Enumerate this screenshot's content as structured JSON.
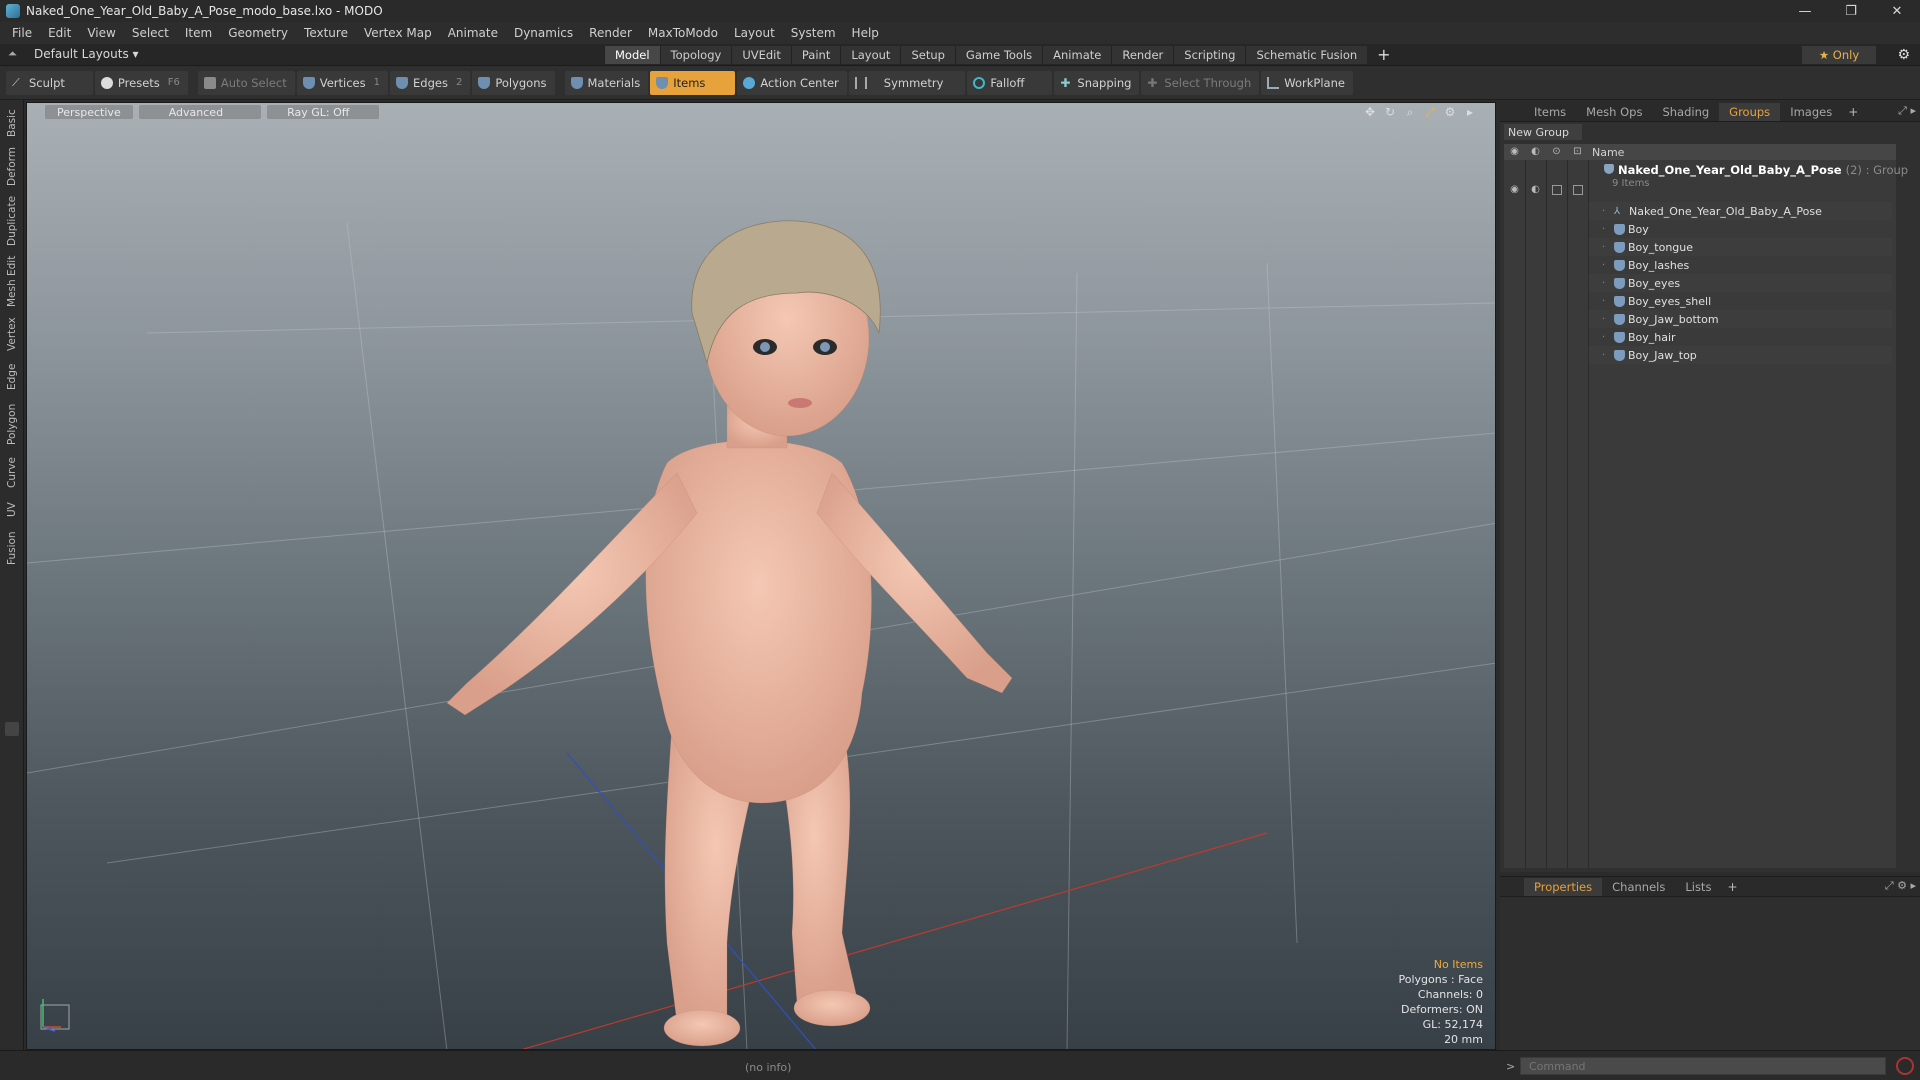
{
  "window": {
    "title": "Naked_One_Year_Old_Baby_A_Pose_modo_base.lxo - MODO"
  },
  "menu": [
    "File",
    "Edit",
    "View",
    "Select",
    "Item",
    "Geometry",
    "Texture",
    "Vertex Map",
    "Animate",
    "Dynamics",
    "Render",
    "MaxToModo",
    "Layout",
    "System",
    "Help"
  ],
  "layout": {
    "selector": "Default Layouts ▾",
    "tabs": [
      "Model",
      "Topology",
      "UVEdit",
      "Paint",
      "Layout",
      "Setup",
      "Game Tools",
      "Animate",
      "Render",
      "Scripting",
      "Schematic Fusion"
    ],
    "active_tab": "Model",
    "only": "★  Only"
  },
  "toolbar": {
    "sculpt": "Sculpt",
    "presets": "Presets",
    "presets_key": "F6",
    "auto_select": "Auto Select",
    "vertices": "Vertices",
    "vertices_key": "1",
    "edges": "Edges",
    "edges_key": "2",
    "polygons": "Polygons",
    "materials": "Materials",
    "items": "Items",
    "action_center": "Action Center",
    "symmetry": "Symmetry",
    "falloff": "Falloff",
    "snapping": "Snapping",
    "select_through": "Select Through",
    "workplane": "WorkPlane"
  },
  "left_tabs": [
    "Basic",
    "Deform",
    "Duplicate",
    "Mesh Edit",
    "Vertex",
    "Edge",
    "Polygon",
    "Curve",
    "UV",
    "Fusion"
  ],
  "viewport": {
    "view": "Perspective",
    "shading": "Advanced",
    "raygl": "Ray GL: Off",
    "info": {
      "selection": "No Items",
      "polygons": "Polygons : Face",
      "channels": "Channels: 0",
      "deformers": "Deformers: ON",
      "gl": "GL: 52,174",
      "scale": "20 mm"
    }
  },
  "panel": {
    "tabs": [
      "Items",
      "Mesh Ops",
      "Shading",
      "Groups",
      "Images"
    ],
    "active_tab": "Groups",
    "new_group": "New Group",
    "column_name": "Name",
    "group": {
      "name": "Naked_One_Year_Old_Baby_A_Pose",
      "count": "(2) : Group",
      "sub": "9 Items"
    },
    "items": [
      "Naked_One_Year_Old_Baby_A_Pose",
      "Boy",
      "Boy_tongue",
      "Boy_lashes",
      "Boy_eyes",
      "Boy_eyes_shell",
      "Boy_Jaw_bottom",
      "Boy_hair",
      "Boy_Jaw_top"
    ]
  },
  "props": {
    "tabs": [
      "Properties",
      "Channels",
      "Lists"
    ],
    "active_tab": "Properties"
  },
  "status": {
    "info": "(no info)"
  },
  "command": {
    "placeholder": "Command"
  }
}
